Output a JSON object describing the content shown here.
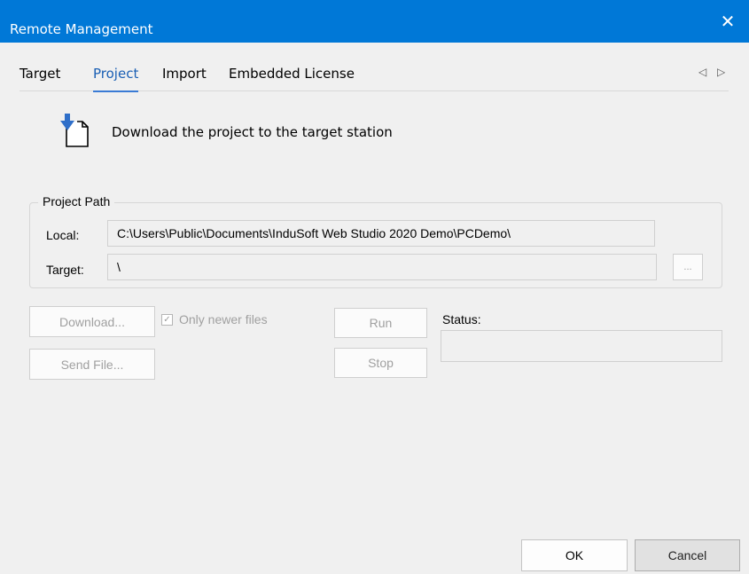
{
  "window": {
    "title": "Remote Management",
    "close_glyph": "✕"
  },
  "tabs": [
    {
      "label": "Target",
      "active": false
    },
    {
      "label": "Project",
      "active": true
    },
    {
      "label": "Import",
      "active": false
    },
    {
      "label": "Embedded License",
      "active": false
    }
  ],
  "tab_scroll": {
    "left_glyph": "◁",
    "right_glyph": "▷"
  },
  "header": {
    "text": "Download the project to the target station",
    "icon": "download-document-icon"
  },
  "project_path": {
    "group_label": "Project Path",
    "local_label": "Local:",
    "local_value": "C:\\Users\\Public\\Documents\\InduSoft Web Studio 2020 Demo\\PCDemo\\",
    "target_label": "Target:",
    "target_value": "\\",
    "browse_label": "..."
  },
  "actions": {
    "download_label": "Download...",
    "only_newer_label": "Only newer files",
    "only_newer_checked": true,
    "send_file_label": "Send File...",
    "run_label": "Run",
    "stop_label": "Stop",
    "status_label": "Status:",
    "status_value": ""
  },
  "footer": {
    "ok_label": "OK",
    "cancel_label": "Cancel"
  },
  "colors": {
    "titlebar": "#0078d7",
    "active_tab": "#1a5fb4",
    "icon_blue": "#2f6fc9"
  }
}
